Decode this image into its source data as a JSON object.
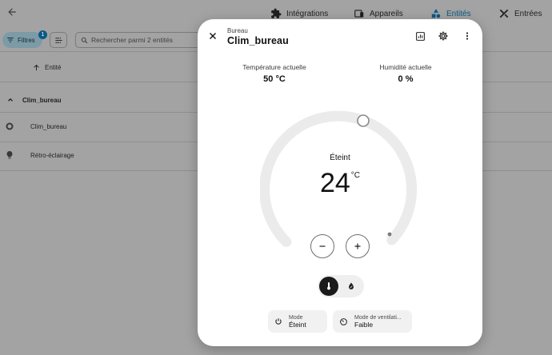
{
  "nav": {
    "tabs": [
      {
        "label": "Intégrations",
        "icon": "puzzle-icon"
      },
      {
        "label": "Appareils",
        "icon": "devices-icon"
      },
      {
        "label": "Entités",
        "icon": "shapes-icon",
        "active": true
      },
      {
        "label": "Entrées",
        "icon": "tools-icon"
      }
    ]
  },
  "toolbar": {
    "filters_label": "Filtres",
    "filters_count": "1",
    "search_placeholder": "Rechercher parmi 2 entités"
  },
  "table": {
    "column_header": "Entité",
    "group_label": "Clim_bureau",
    "rows": [
      {
        "name": "Clim_bureau",
        "icon": "thermostat-icon"
      },
      {
        "name": "Rétro-éclairage",
        "icon": "bulb-icon"
      }
    ]
  },
  "dialog": {
    "subtitle": "Bureau",
    "title": "Clim_bureau",
    "current_temp_label": "Température actuelle",
    "current_temp_value": "50 °C",
    "current_humidity_label": "Humidité actuelle",
    "current_humidity_value": "0 %",
    "state": "Éteint",
    "target_temp": "24",
    "target_unit": "°C",
    "features": [
      {
        "label": "Mode",
        "value": "Éteint",
        "icon": "power-icon"
      },
      {
        "label": "Mode de ventilati...",
        "value": "Faible",
        "icon": "fan-speed-icon"
      }
    ]
  },
  "colors": {
    "accent": "#0a5a86",
    "overlay": "#a3a3a3",
    "dial_track": "#ebebeb",
    "mode_active": "#1a1a1a"
  }
}
